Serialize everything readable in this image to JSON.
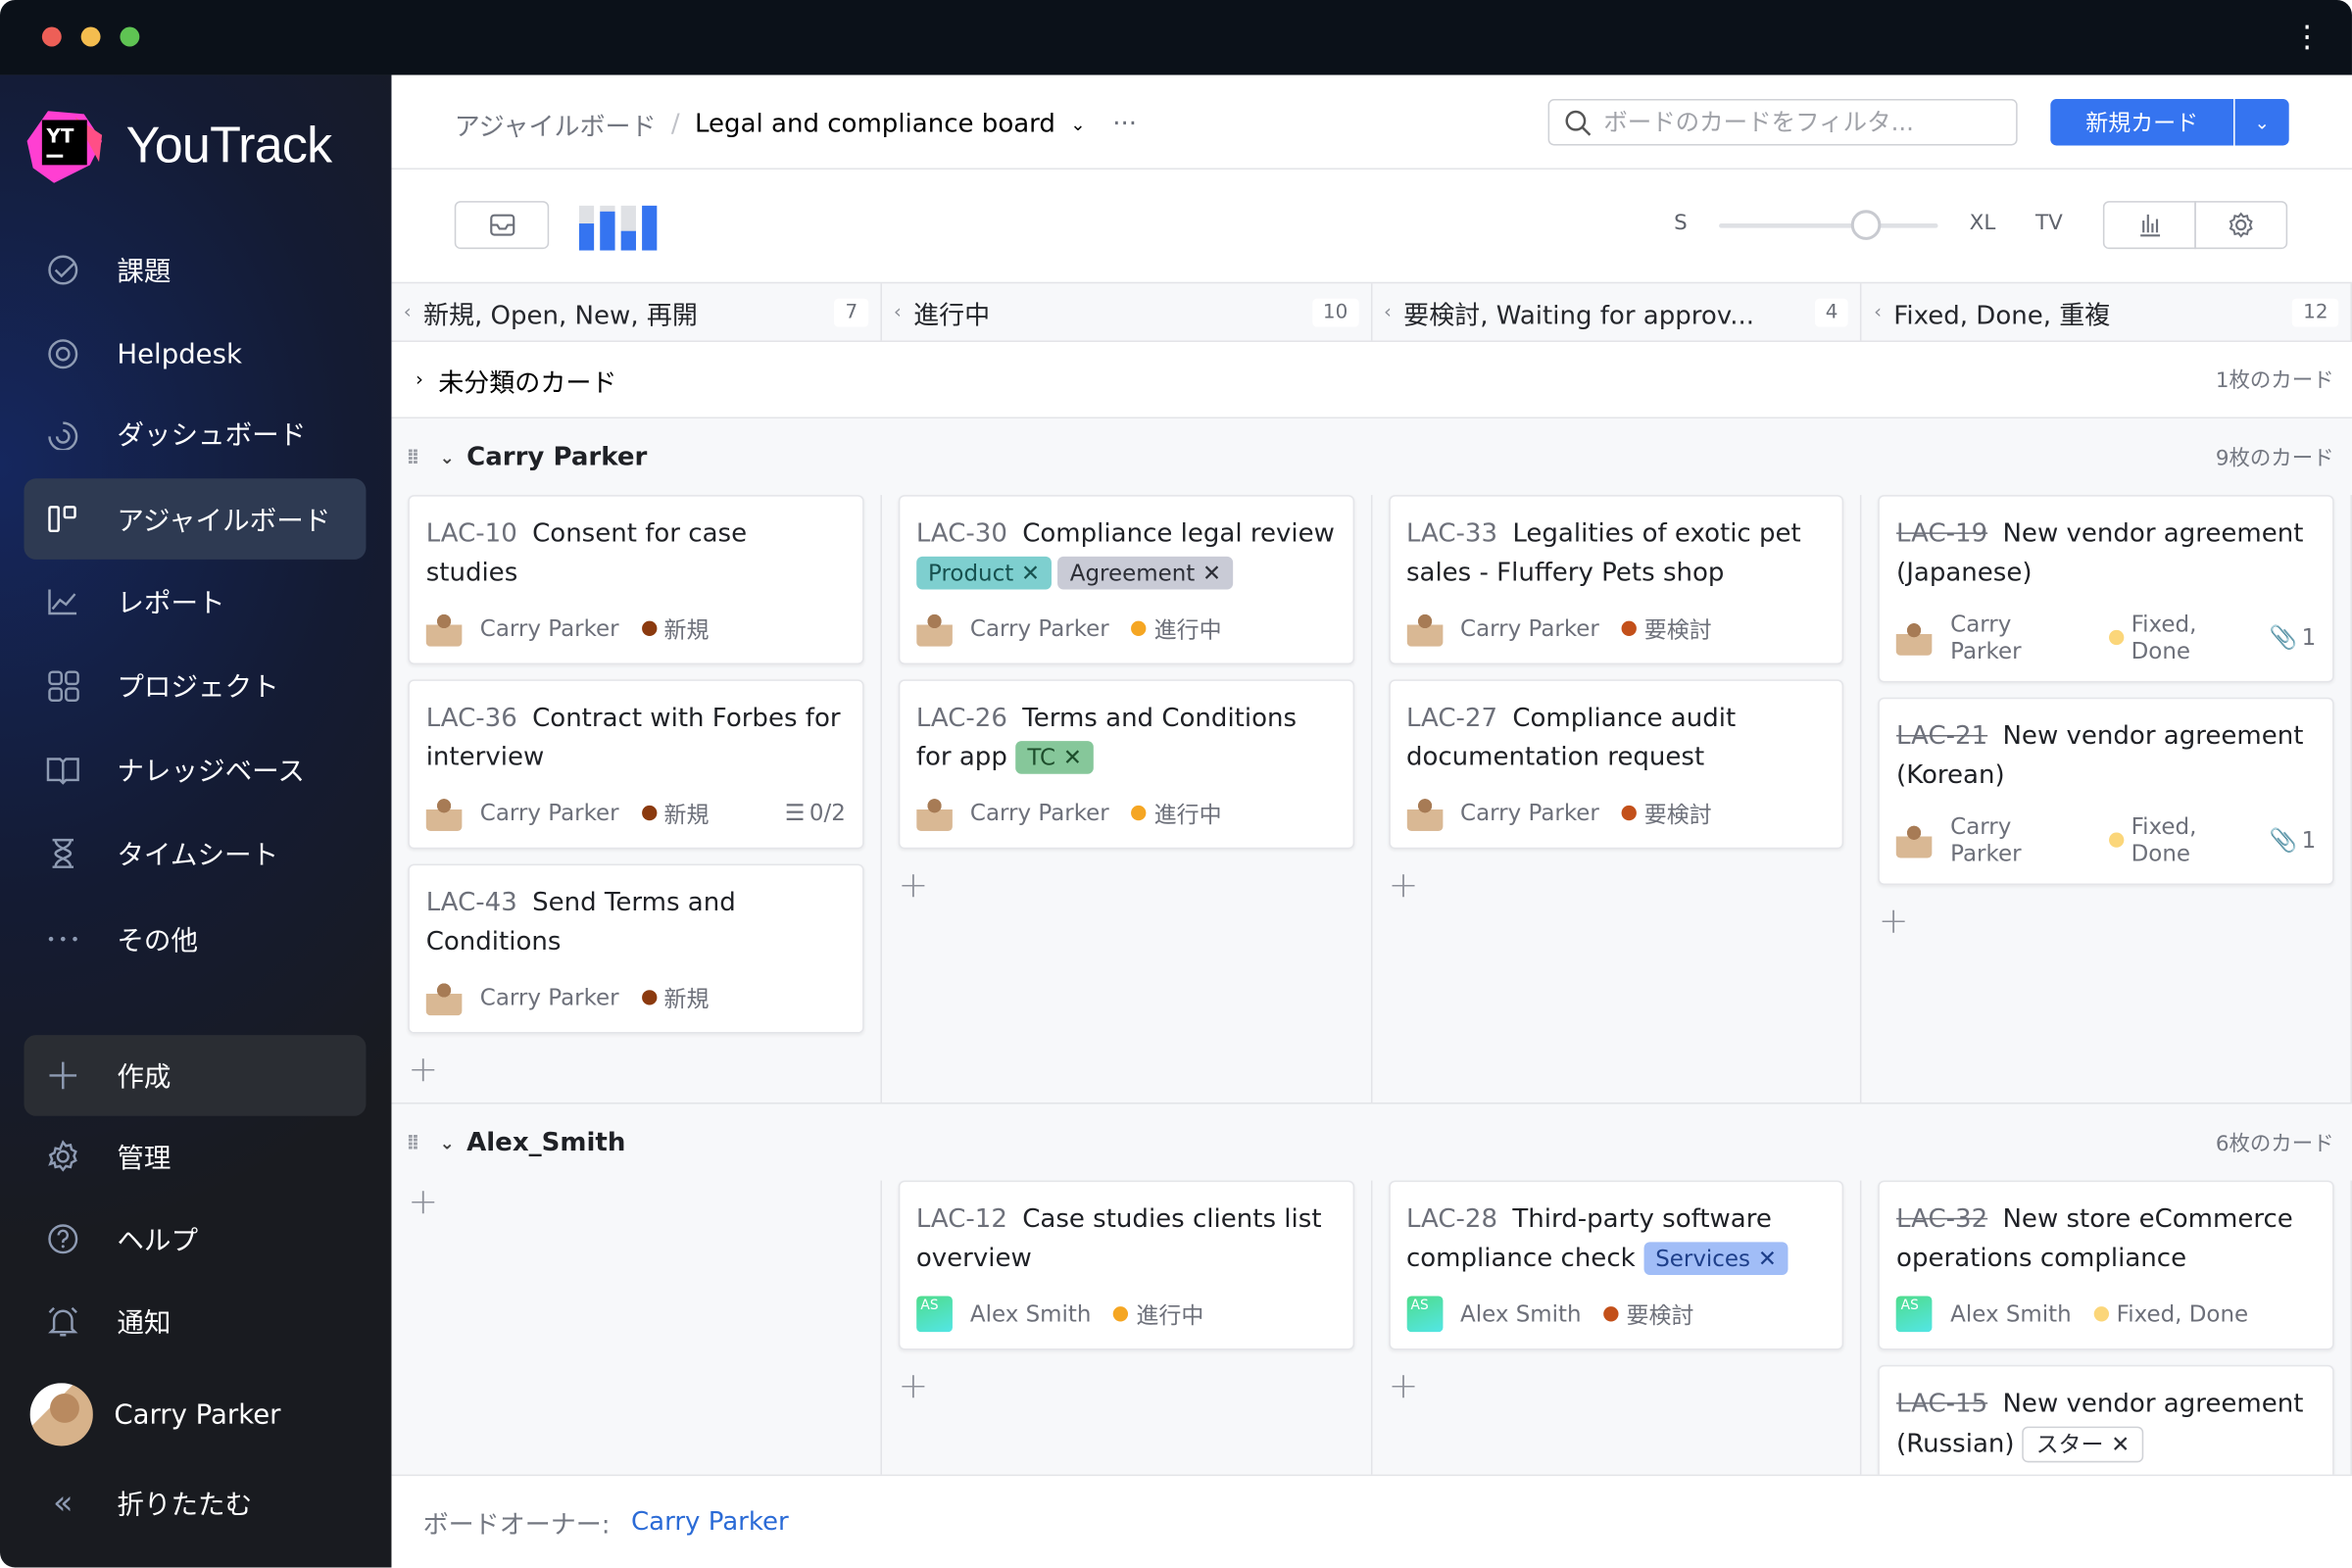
{
  "app": {
    "name": "YouTrack"
  },
  "sidebar": {
    "items": [
      {
        "label": "課題",
        "icon": "check-circle-icon"
      },
      {
        "label": "Helpdesk",
        "icon": "lifebuoy-icon"
      },
      {
        "label": "ダッシュボード",
        "icon": "dashboard-icon"
      },
      {
        "label": "アジャイルボード",
        "icon": "agile-board-icon",
        "active": true
      },
      {
        "label": "レポート",
        "icon": "report-chart-icon"
      },
      {
        "label": "プロジェクト",
        "icon": "projects-grid-icon"
      },
      {
        "label": "ナレッジベース",
        "icon": "book-icon"
      },
      {
        "label": "タイムシート",
        "icon": "hourglass-icon"
      },
      {
        "label": "その他",
        "icon": "more-icon"
      }
    ],
    "bottom": [
      {
        "label": "作成",
        "icon": "plus-icon"
      },
      {
        "label": "管理",
        "icon": "gear-icon"
      },
      {
        "label": "ヘルプ",
        "icon": "help-icon"
      },
      {
        "label": "通知",
        "icon": "bell-icon"
      }
    ],
    "user": "Carry Parker",
    "collapse": "折りたたむ"
  },
  "header": {
    "breadcrumb_root": "アジャイルボード",
    "board_name": "Legal and compliance board",
    "search_placeholder": "ボードのカードをフィルタ...",
    "new_card": "新規カード"
  },
  "toolbar": {
    "size_s": "S",
    "size_xl": "XL",
    "size_tv": "TV",
    "card_size_level": 0.67
  },
  "columns": [
    {
      "title": "新規, Open, New, 再開",
      "count": "7"
    },
    {
      "title": "進行中",
      "count": "10"
    },
    {
      "title": "要検討, Waiting for approv...",
      "count": "4"
    },
    {
      "title": "Fixed, Done, 重複",
      "count": "12"
    }
  ],
  "uncategorized": {
    "label": "未分類のカード",
    "count": "1枚のカード"
  },
  "colors": {
    "accent": "#3574f0",
    "new": "#8b3a0f",
    "in_progress": "#f5a623",
    "review": "#c3501a",
    "done": "#fbd67a"
  },
  "swimlanes": [
    {
      "name": "Carry Parker",
      "count": "9枚のカード",
      "columns": [
        [
          {
            "id": "LAC-10",
            "title": "Consent for case studies",
            "assignee": "Carry Parker",
            "avatar": "photo",
            "state": "新規",
            "state_color": "#8b3a0f"
          },
          {
            "id": "LAC-36",
            "title": "Contract with Forbes for interview",
            "assignee": "Carry Parker",
            "avatar": "photo",
            "state": "新規",
            "state_color": "#8b3a0f",
            "subtasks": "0/2"
          },
          {
            "id": "LAC-43",
            "title": "Send Terms and Conditions",
            "assignee": "Carry Parker",
            "avatar": "photo",
            "state": "新規",
            "state_color": "#8b3a0f"
          }
        ],
        [
          {
            "id": "LAC-30",
            "title": "Compliance legal review",
            "tags": [
              {
                "label": "Product",
                "bg": "#7ecfcf",
                "fg": "#17514f"
              },
              {
                "label": "Agreement",
                "bg": "#c9cbd6",
                "fg": "#2c2e36"
              }
            ],
            "assignee": "Carry Parker",
            "avatar": "photo",
            "state": "進行中",
            "state_color": "#f5a623"
          },
          {
            "id": "LAC-26",
            "title": "Terms and Conditions for app",
            "tags": [
              {
                "label": "TC",
                "bg": "#86c79a",
                "fg": "#1d4d2b"
              }
            ],
            "assignee": "Carry Parker",
            "avatar": "photo",
            "state": "進行中",
            "state_color": "#f5a623"
          }
        ],
        [
          {
            "id": "LAC-33",
            "title": "Legalities of exotic pet sales - Fluffery Pets shop",
            "assignee": "Carry Parker",
            "avatar": "photo",
            "state": "要検討",
            "state_color": "#c3501a"
          },
          {
            "id": "LAC-27",
            "title": "Compliance audit documentation request",
            "assignee": "Carry Parker",
            "avatar": "photo",
            "state": "要検討",
            "state_color": "#c3501a"
          }
        ],
        [
          {
            "id": "LAC-19",
            "resolved": true,
            "title": "New vendor agreement (Japanese)",
            "assignee": "Carry Parker",
            "avatar": "photo",
            "state": "Fixed, Done",
            "state_color": "#fbd67a",
            "attachments": "1"
          },
          {
            "id": "LAC-21",
            "resolved": true,
            "title": "New vendor agreement (Korean)",
            "assignee": "Carry Parker",
            "avatar": "photo",
            "state": "Fixed, Done",
            "state_color": "#fbd67a",
            "attachments": "1"
          }
        ]
      ]
    },
    {
      "name": "Alex_Smith",
      "count": "6枚のカード",
      "columns": [
        [],
        [
          {
            "id": "LAC-12",
            "title": "Case studies clients list overview",
            "assignee": "Alex Smith",
            "avatar": "AS",
            "state": "進行中",
            "state_color": "#f5a623"
          }
        ],
        [
          {
            "id": "LAC-28",
            "title": "Third-party software compliance check",
            "tags": [
              {
                "label": "Services",
                "bg": "#a1bdf7",
                "fg": "#1e3f8a"
              }
            ],
            "assignee": "Alex Smith",
            "avatar": "AS",
            "state": "要検討",
            "state_color": "#c3501a"
          }
        ],
        [
          {
            "id": "LAC-32",
            "resolved": true,
            "title": "New store eCommerce operations compliance",
            "assignee": "Alex Smith",
            "avatar": "AS",
            "state": "Fixed, Done",
            "state_color": "#fbd67a"
          },
          {
            "id": "LAC-15",
            "resolved": true,
            "title": "New vendor agreement (Russian)",
            "tags": [
              {
                "label": "スター",
                "bg": "#ffffff",
                "fg": "#2c2e36",
                "border": "#cfd1d6"
              }
            ],
            "assignee": "Alex Smith",
            "avatar": "AS",
            "state": "Fixed, Done",
            "state_color": "#fbd67a"
          }
        ]
      ]
    }
  ],
  "footer": {
    "owner_label": "ボードオーナー:",
    "owner": "Carry Parker"
  }
}
